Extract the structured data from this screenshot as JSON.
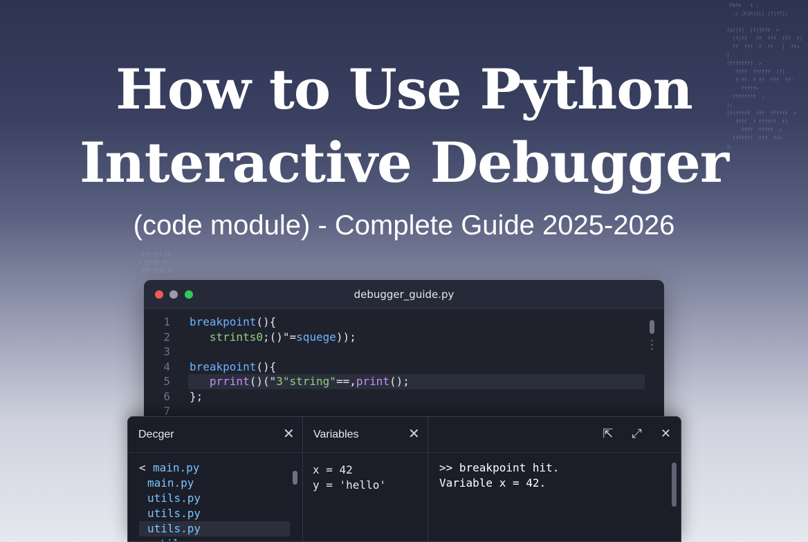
{
  "headline": {
    "line1": "How to Use Python",
    "line2": "Interactive Debugger",
    "subtitle": "(code module) - Complete Guide 2025-2026"
  },
  "editor": {
    "filename": "debugger_guide.py",
    "lines": [
      {
        "num": "1",
        "parts": [
          {
            "t": "breakpoint",
            "c": "blue"
          },
          {
            "t": "(){",
            "c": "white"
          }
        ]
      },
      {
        "num": "2",
        "parts": [
          {
            "t": "   strints0",
            "c": "green"
          },
          {
            "t": ";()\"=",
            "c": "white"
          },
          {
            "t": "squege",
            "c": "blue"
          },
          {
            "t": "));",
            "c": "white"
          }
        ]
      },
      {
        "num": "3",
        "parts": []
      },
      {
        "num": "4",
        "parts": [
          {
            "t": "breakpoint",
            "c": "blue"
          },
          {
            "t": "(){",
            "c": "white"
          }
        ]
      },
      {
        "num": "5",
        "parts": [
          {
            "t": "   prrint",
            "c": "purple"
          },
          {
            "t": "()(\"",
            "c": "white"
          },
          {
            "t": "3\"string\"",
            "c": "green"
          },
          {
            "t": "==,",
            "c": "white"
          },
          {
            "t": "print",
            "c": "purple"
          },
          {
            "t": "();",
            "c": "white"
          }
        ]
      },
      {
        "num": "6",
        "parts": [
          {
            "t": "};",
            "c": "white"
          }
        ]
      },
      {
        "num": "7",
        "parts": []
      }
    ]
  },
  "debugger_panel": {
    "files_title": "Decger",
    "files": [
      {
        "arrow": "<",
        "name": "main.py"
      },
      {
        "arrow": "",
        "name": "main.py"
      },
      {
        "arrow": "",
        "name": "utils.py"
      },
      {
        "arrow": "",
        "name": "utils.py"
      },
      {
        "arrow": "",
        "name": "utils.py"
      },
      {
        "arrow": ">",
        "name": "utils.py"
      }
    ],
    "variables_title": "Variables",
    "variables": [
      "x = 42",
      "y = 'hello'"
    ],
    "console": [
      ">> breakpoint hit.",
      "Variable x = 42."
    ]
  },
  "colors": {
    "blue": "#6fb3ff",
    "green": "#8fd37a",
    "purple": "#c98cf5",
    "white": "#e6e8ee"
  }
}
